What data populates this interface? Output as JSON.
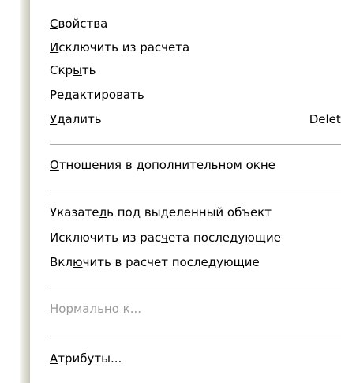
{
  "menu": {
    "items": [
      {
        "pre": "",
        "key": "С",
        "post": "войства",
        "shortcut": "",
        "disabled": false
      },
      {
        "pre": "",
        "key": "И",
        "post": "сключить из расчета",
        "shortcut": "",
        "disabled": false
      },
      {
        "pre": "Скр",
        "key": "ы",
        "post": "ть",
        "shortcut": "",
        "disabled": false
      },
      {
        "pre": "",
        "key": "Р",
        "post": "едактировать",
        "shortcut": "",
        "disabled": false
      },
      {
        "pre": "",
        "key": "У",
        "post": "далить",
        "shortcut": "Delete",
        "disabled": false
      },
      {
        "pre": "",
        "key": "О",
        "post": "тношения в дополнительном окне",
        "shortcut": "",
        "disabled": false
      },
      {
        "pre": "Указате",
        "key": "л",
        "post": "ь под выделенный объект",
        "shortcut": "",
        "disabled": false
      },
      {
        "pre": "Исключить из рас",
        "key": "ч",
        "post": "ета последующие",
        "shortcut": "",
        "disabled": false
      },
      {
        "pre": "Вкл",
        "key": "ю",
        "post": "чить в расчет последующие",
        "shortcut": "",
        "disabled": false
      },
      {
        "pre": "",
        "key": "Н",
        "post": "ормально к...",
        "shortcut": "",
        "disabled": true
      },
      {
        "pre": "",
        "key": "А",
        "post": "трибуты...",
        "shortcut": "",
        "disabled": false
      }
    ]
  }
}
